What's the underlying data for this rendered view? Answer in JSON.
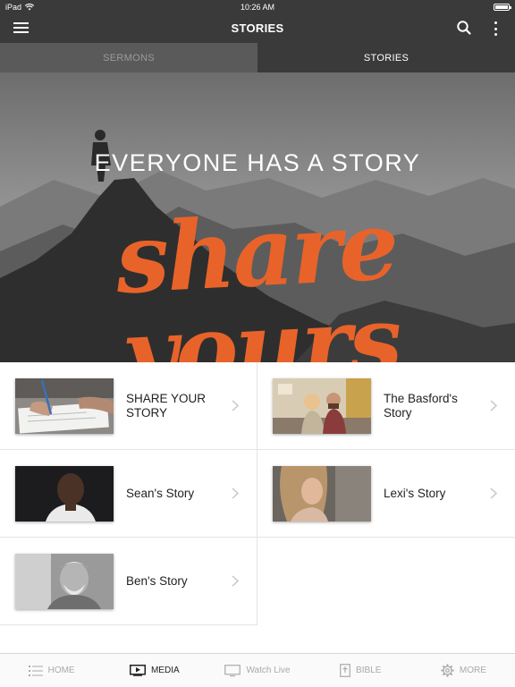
{
  "status_bar": {
    "device": "iPad",
    "time": "10:26 AM"
  },
  "nav": {
    "title": "STORIES"
  },
  "tabs": [
    {
      "label": "SERMONS"
    },
    {
      "label": "STORIES"
    }
  ],
  "hero": {
    "headline": "EVERYONE HAS A STORY",
    "script": "share yours"
  },
  "stories": [
    {
      "label": "SHARE YOUR STORY"
    },
    {
      "label": "The Basford's Story"
    },
    {
      "label": "Sean's Story"
    },
    {
      "label": "Lexi's Story"
    },
    {
      "label": "Ben's Story"
    }
  ],
  "tab_bar": [
    {
      "label": "HOME",
      "icon": "list-icon"
    },
    {
      "label": "MEDIA",
      "icon": "media-icon"
    },
    {
      "label": "Watch Live",
      "icon": "monitor-icon"
    },
    {
      "label": "BIBLE",
      "icon": "bible-icon"
    },
    {
      "label": "MORE",
      "icon": "gear-icon"
    }
  ],
  "colors": {
    "bar": "#3a3a3a",
    "accent": "#e8632a"
  }
}
